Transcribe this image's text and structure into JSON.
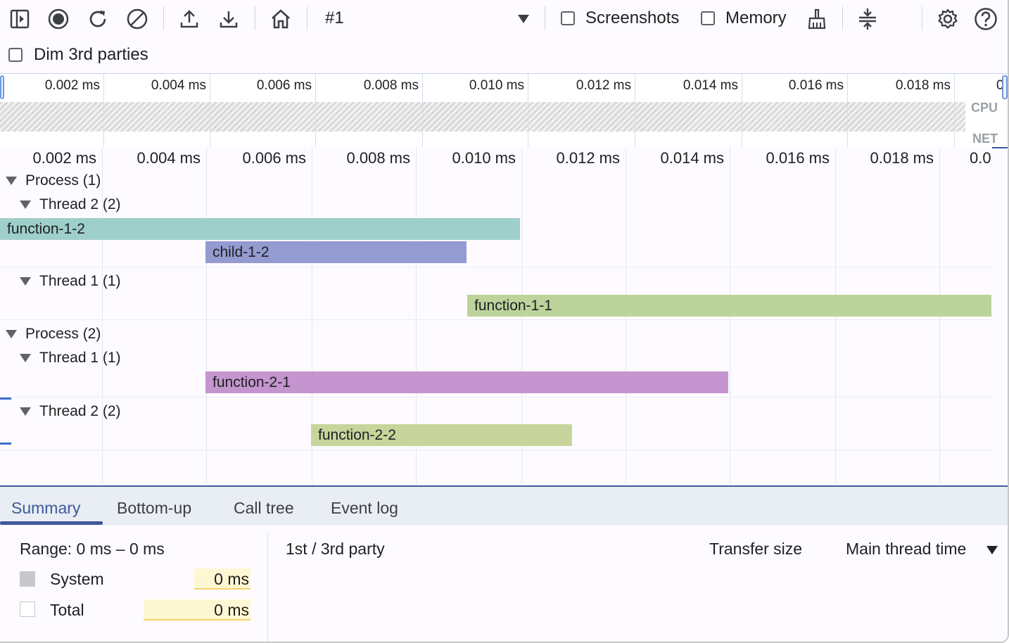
{
  "toolbar": {
    "recording_label": "#1",
    "screenshots_label": "Screenshots",
    "memory_label": "Memory",
    "dim_3rd_parties_label": "Dim 3rd parties"
  },
  "overview": {
    "ticks": [
      "0.002 ms",
      "0.004 ms",
      "0.006 ms",
      "0.008 ms",
      "0.010 ms",
      "0.012 ms",
      "0.014 ms",
      "0.016 ms",
      "0.018 ms",
      "0"
    ],
    "cpu_label": "CPU",
    "net_label": "NET"
  },
  "flame": {
    "ticks": [
      "0.002 ms",
      "0.004 ms",
      "0.006 ms",
      "0.008 ms",
      "0.010 ms",
      "0.012 ms",
      "0.014 ms",
      "0.016 ms",
      "0.018 ms",
      "0.0"
    ],
    "groups": {
      "process1": "Process (1)",
      "p1_thread2": "Thread 2 (2)",
      "p1_thread1": "Thread 1 (1)",
      "process2": "Process (2)",
      "p2_thread1": "Thread 1 (1)",
      "p2_thread2": "Thread 2 (2)"
    },
    "events": {
      "function_1_2": "function-1-2",
      "child_1_2": "child-1-2",
      "function_1_1": "function-1-1",
      "function_2_1": "function-2-1",
      "function_2_2": "function-2-2"
    },
    "colors": {
      "function_1_2": "#9fcfca",
      "child_1_2": "#939bd1",
      "function_1_1": "#bcd39b",
      "function_2_1": "#c595cf",
      "function_2_2": "#c7d59c"
    }
  },
  "tabs": [
    "Summary",
    "Bottom-up",
    "Call tree",
    "Event log"
  ],
  "summary": {
    "range": "Range: 0 ms – 0 ms",
    "rows": [
      {
        "label": "System",
        "value": "0 ms"
      },
      {
        "label": "Total",
        "value": "0 ms"
      }
    ],
    "party_header": "1st / 3rd party",
    "transfer_size_header": "Transfer size",
    "main_thread_header": "Main thread time"
  }
}
